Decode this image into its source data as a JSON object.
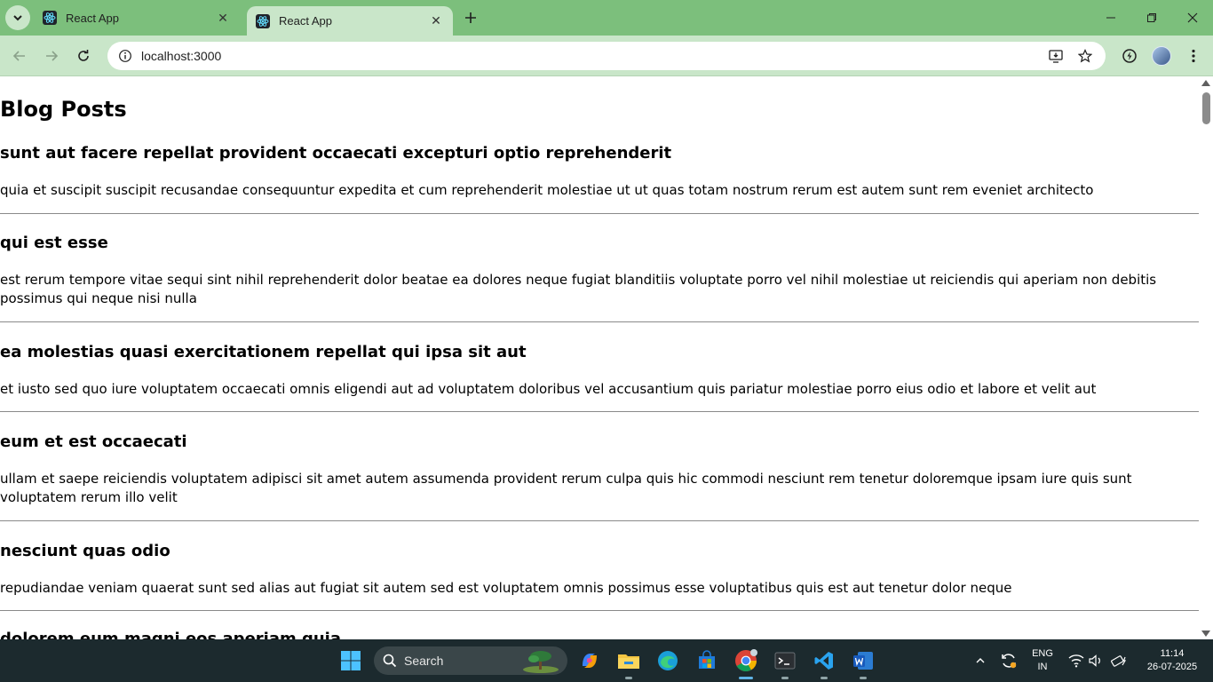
{
  "browser": {
    "tabs": [
      {
        "title": "React App",
        "active": false
      },
      {
        "title": "React App",
        "active": true
      }
    ],
    "url": "localhost:3000",
    "accent_color": "#7cbf7c",
    "toolbar_color": "#c9e6c9"
  },
  "page": {
    "heading": "Blog Posts",
    "posts": [
      {
        "title": "sunt aut facere repellat provident occaecati excepturi optio reprehenderit",
        "body": "quia et suscipit suscipit recusandae consequuntur expedita et cum reprehenderit molestiae ut ut quas totam nostrum rerum est autem sunt rem eveniet architecto"
      },
      {
        "title": "qui est esse",
        "body": "est rerum tempore vitae sequi sint nihil reprehenderit dolor beatae ea dolores neque fugiat blanditiis voluptate porro vel nihil molestiae ut reiciendis qui aperiam non debitis possimus qui neque nisi nulla"
      },
      {
        "title": "ea molestias quasi exercitationem repellat qui ipsa sit aut",
        "body": "et iusto sed quo iure voluptatem occaecati omnis eligendi aut ad voluptatem doloribus vel accusantium quis pariatur molestiae porro eius odio et labore et velit aut"
      },
      {
        "title": "eum et est occaecati",
        "body": "ullam et saepe reiciendis voluptatem adipisci sit amet autem assumenda provident rerum culpa quis hic commodi nesciunt rem tenetur doloremque ipsam iure quis sunt voluptatem rerum illo velit"
      },
      {
        "title": "nesciunt quas odio",
        "body": "repudiandae veniam quaerat sunt sed alias aut fugiat sit autem sed est voluptatem omnis possimus esse voluptatibus quis est aut tenetur dolor neque"
      },
      {
        "title": "dolorem eum magni eos aperiam quia",
        "body": ""
      }
    ]
  },
  "taskbar": {
    "search_placeholder": "Search",
    "language": "ENG",
    "region": "IN",
    "time": "11:14",
    "date": "26-07-2025"
  }
}
